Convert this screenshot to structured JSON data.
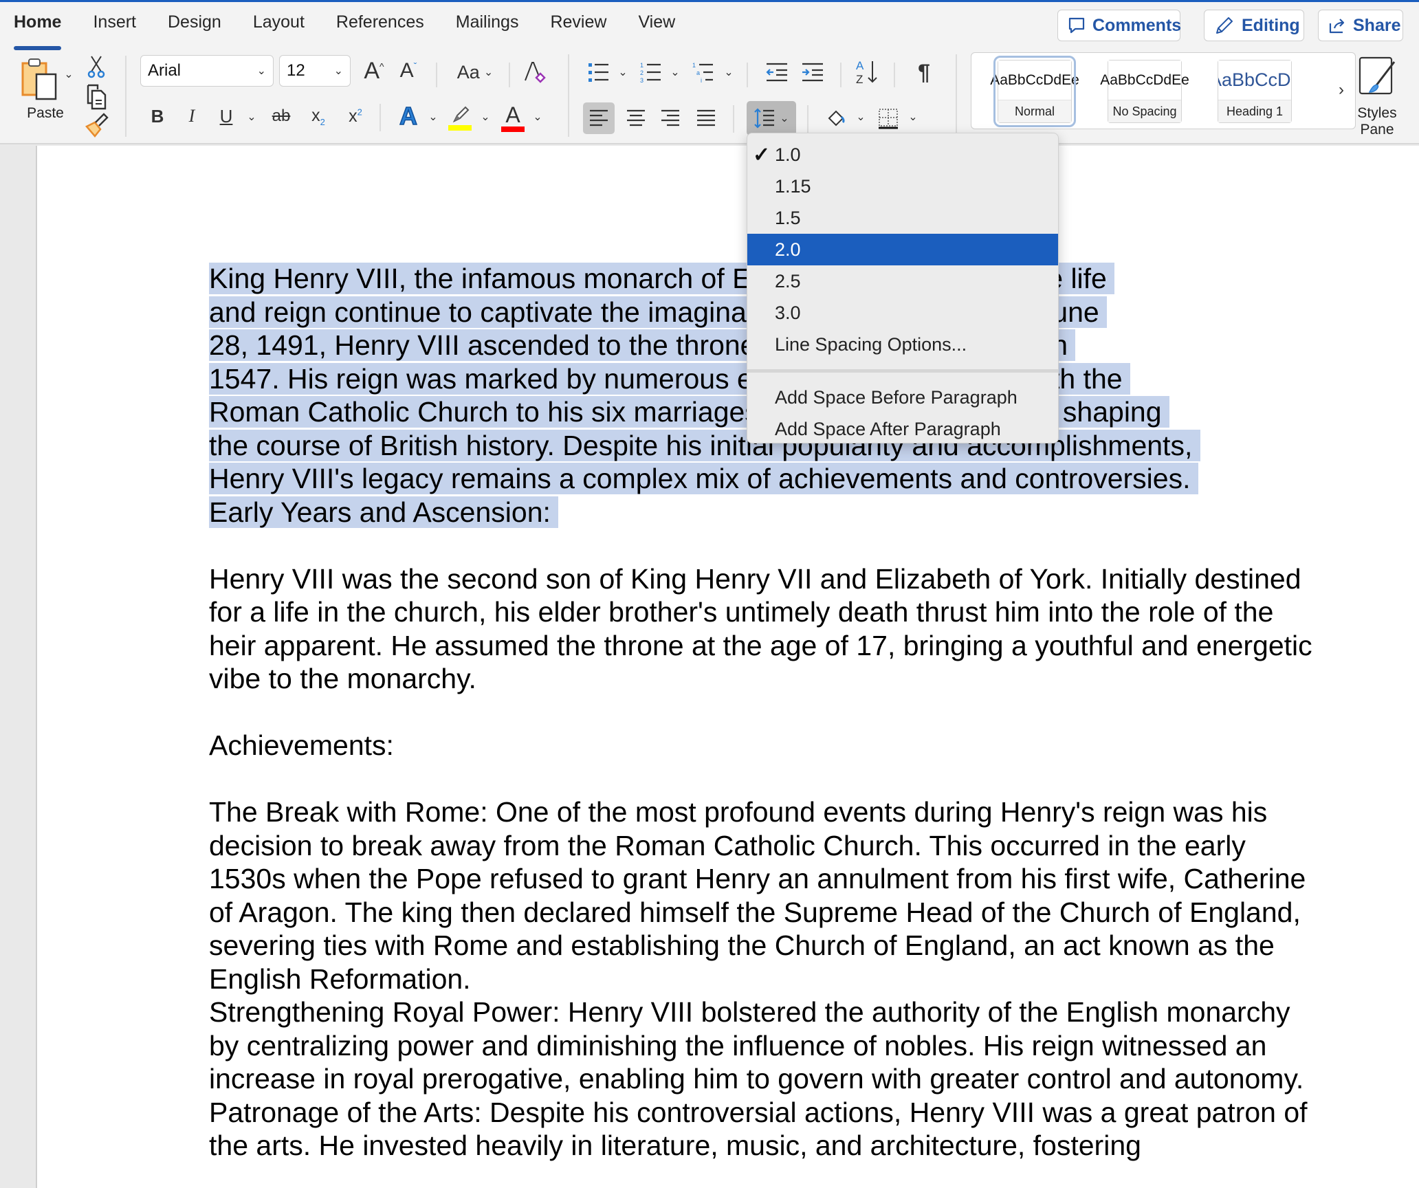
{
  "app": {
    "tabs": [
      {
        "label": "Home",
        "active": true
      },
      {
        "label": "Insert"
      },
      {
        "label": "Design"
      },
      {
        "label": "Layout"
      },
      {
        "label": "References"
      },
      {
        "label": "Mailings"
      },
      {
        "label": "Review"
      },
      {
        "label": "View"
      }
    ],
    "top_buttons": {
      "comments": "Comments",
      "editing": "Editing",
      "share": "Share"
    }
  },
  "ribbon": {
    "clipboard": {
      "paste_label": "Paste"
    },
    "font": {
      "family": "Arial",
      "size": "12",
      "change_case_label": "Aa"
    },
    "colors": {
      "highlight": "#ffff00",
      "font_color": "#ff0000",
      "accent": "#2456a6"
    },
    "styles": [
      {
        "sample": "AaBbCcDdEe",
        "label": "Normal",
        "selected": true
      },
      {
        "sample": "AaBbCcDdEe",
        "label": "No Spacing"
      },
      {
        "sample": "AaBbCcDc",
        "label": "Heading 1"
      }
    ],
    "styles_pane_label_1": "Styles",
    "styles_pane_label_2": "Pane"
  },
  "line_spacing_menu": {
    "items": [
      {
        "label": "1.0",
        "checked": true
      },
      {
        "label": "1.15"
      },
      {
        "label": "1.5"
      },
      {
        "label": "2.0",
        "highlighted": true
      },
      {
        "label": "2.5"
      },
      {
        "label": "3.0"
      },
      {
        "label": "Line Spacing Options..."
      }
    ],
    "paragraph_items": [
      {
        "label": "Add Space Before Paragraph"
      },
      {
        "label": "Add Space After Paragraph"
      }
    ],
    "check_glyph": "✓"
  },
  "document": {
    "selected_lines": [
      "King Henry VIII, the infamous monarch of England, is a figure whose life ",
      "and reign continue to captivate the imagination of people. Born on June ",
      "28, 1491, Henry VIII ascended to the throne in 1509 until his death in ",
      "1547. His reign was marked by numerous events, from the break with the ",
      "Roman Catholic Church to his six marriages, played a crucial role in shaping ",
      "the course of British history. Despite his initial popularity and accomplishments, ",
      "Henry VIII's legacy remains a complex mix of achievements and controversies. ",
      "Early Years and Ascension: "
    ],
    "paragraphs": [
      "",
      "Henry VIII was the second son of King Henry VII and Elizabeth of York. Initially destined for a life in the church, his elder brother's untimely death thrust him into the role of the heir apparent. He assumed the throne at the age of 17, bringing a youthful and energetic vibe to the monarchy.",
      "",
      "Achievements:",
      "",
      "The Break with Rome: One of the most profound events during Henry's reign was his decision to break away from the Roman Catholic Church. This occurred in the early 1530s when the Pope refused to grant Henry an annulment from his first wife, Catherine of Aragon. The king then declared himself the Supreme Head of the Church of England, severing ties with Rome and establishing the Church of England, an act known as the English Reformation.",
      "Strengthening Royal Power: Henry VIII bolstered the authority of the English monarchy by centralizing power and diminishing the influence of nobles. His reign witnessed an increase in royal prerogative, enabling him to govern with greater control and autonomy.",
      "Patronage of the Arts: Despite his controversial actions, Henry VIII was a great patron of the arts. He invested heavily in literature, music, and architecture, fostering"
    ]
  }
}
